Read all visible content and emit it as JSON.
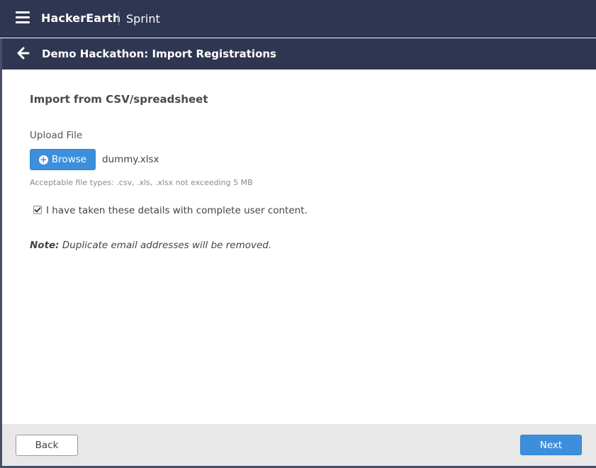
{
  "header": {
    "brand": "HackerEarth",
    "product": "Sprint"
  },
  "subheader": {
    "title": "Demo Hackathon: Import Registrations"
  },
  "form": {
    "section_title": "Import from CSV/spreadsheet",
    "upload_label": "Upload File",
    "browse_label": "Browse",
    "file_name": "dummy.xlsx",
    "hint": "Acceptable file types: .csv, .xls, .xlsx not exceeding 5 MB",
    "consent_checked": true,
    "consent_label": "I have taken these details with complete user content.",
    "note_label": "Note:",
    "note_text": " Duplicate email addresses will be removed."
  },
  "footer": {
    "back_label": "Back",
    "next_label": "Next"
  },
  "colors": {
    "nav_bg": "#2f3651",
    "primary": "#3d8fdc",
    "footer_bg": "#e8e8e8"
  }
}
